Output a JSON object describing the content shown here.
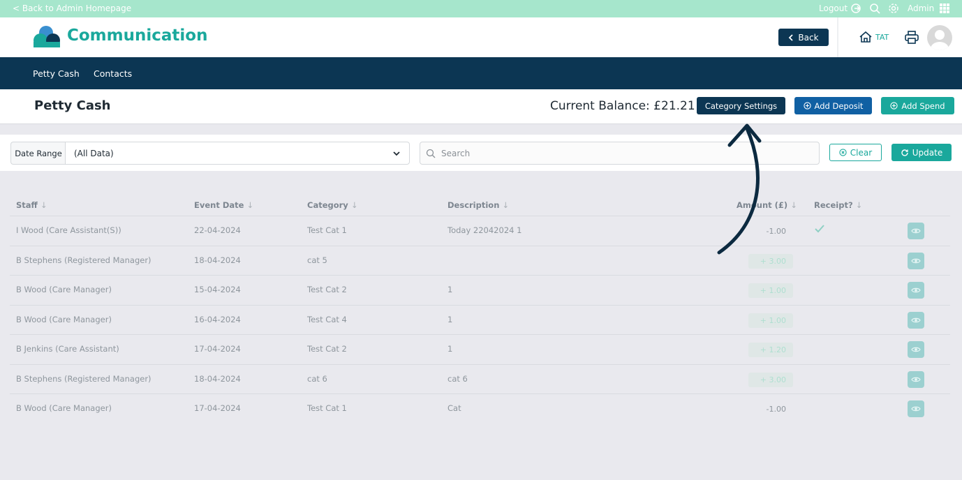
{
  "topbar": {
    "back_link": "< Back to Admin Homepage",
    "logout": "Logout",
    "admin": "Admin"
  },
  "header": {
    "app_title": "Communication",
    "back_button": "Back",
    "org_code": "TAT"
  },
  "nav": {
    "tabs": [
      {
        "label": "Petty Cash",
        "active": true
      },
      {
        "label": "Contacts",
        "active": false
      }
    ]
  },
  "page": {
    "title": "Petty Cash",
    "balance": "Current Balance: £21.21",
    "category_settings": "Category Settings",
    "add_deposit": "Add Deposit",
    "add_spend": "Add Spend"
  },
  "filter": {
    "date_range_label": "Date Range",
    "date_range_value": "(All Data)",
    "search_placeholder": "Search",
    "clear": "Clear",
    "update": "Update"
  },
  "table": {
    "headers": [
      "Staff",
      "Event Date",
      "Category",
      "Description",
      "Amount (£)",
      "Receipt?"
    ],
    "rows": [
      {
        "staff": "I Wood (Care Assistant(S))",
        "date": "22-04-2024",
        "category": "Test Cat 1",
        "description": "Today 22042024 1",
        "amount": "-1.00",
        "positive": false,
        "receipt": true
      },
      {
        "staff": "B Stephens (Registered Manager)",
        "date": "18-04-2024",
        "category": "cat 5",
        "description": "",
        "amount": "+ 3.00",
        "positive": true,
        "receipt": false
      },
      {
        "staff": "B Wood (Care Manager)",
        "date": "15-04-2024",
        "category": "Test Cat 2",
        "description": "1",
        "amount": "+ 1.00",
        "positive": true,
        "receipt": false
      },
      {
        "staff": "B Wood (Care Manager)",
        "date": "16-04-2024",
        "category": "Test Cat 4",
        "description": "1",
        "amount": "+ 1.00",
        "positive": true,
        "receipt": false
      },
      {
        "staff": "B Jenkins (Care Assistant)",
        "date": "17-04-2024",
        "category": "Test Cat 2",
        "description": "1",
        "amount": "+ 1.20",
        "positive": true,
        "receipt": false
      },
      {
        "staff": "B Stephens (Registered Manager)",
        "date": "18-04-2024",
        "category": "cat 6",
        "description": "cat 6",
        "amount": "+ 3.00",
        "positive": true,
        "receipt": false
      },
      {
        "staff": "B Wood (Care Manager)",
        "date": "17-04-2024",
        "category": "Test Cat 1",
        "description": "Cat",
        "amount": "-1.00",
        "positive": false,
        "receipt": false
      }
    ]
  },
  "colors": {
    "navy": "#0c3653",
    "teal": "#1aa89c",
    "blue": "#1060a3",
    "mint": "#a6e6cc"
  }
}
